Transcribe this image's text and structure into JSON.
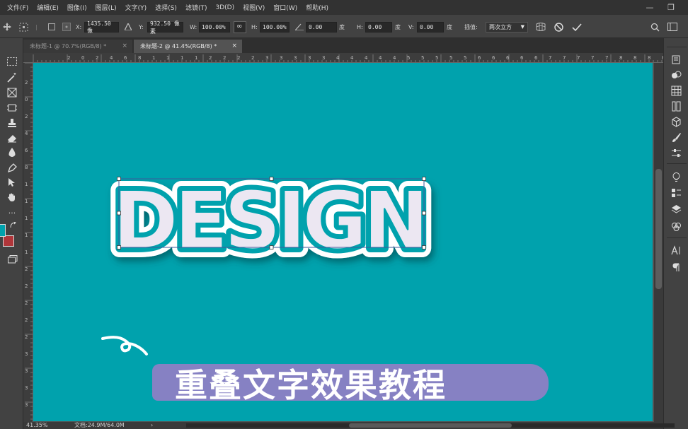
{
  "menu": [
    "文件(F)",
    "编辑(E)",
    "图像(I)",
    "图层(L)",
    "文字(Y)",
    "选择(S)",
    "滤镜(T)",
    "3D(D)",
    "视图(V)",
    "窗口(W)",
    "帮助(H)"
  ],
  "window_controls": {
    "minimize": "—",
    "restore": "❐"
  },
  "options": {
    "x_label": "X:",
    "x_value": "1435.50 像",
    "y_label": "Y:",
    "y_value": "932.50 像素",
    "w_label": "W:",
    "w_value": "100.00%",
    "h_label": "H:",
    "h_value": "100.00%",
    "angle_value": "0.00",
    "angle_unit": "度",
    "hskew_label": "H:",
    "hskew_value": "0.00",
    "hskew_unit": "度",
    "vskew_label": "V:",
    "vskew_value": "0.00",
    "vskew_unit": "度",
    "interp_label": "插值:",
    "interp_value": "两次立方"
  },
  "tabs": [
    {
      "label": "未标题-1 @ 70.7%(RGB/8) *",
      "close": "×"
    },
    {
      "label": "未标题-2 @ 41.4%(RGB/8) *",
      "close": "×"
    }
  ],
  "canvas": {
    "headline": "DESIGN",
    "subtitle": "重叠文字效果教程",
    "background": "#00a2ad",
    "text_fill": "#ece7f2",
    "text_stroke": "#00a2ad",
    "banner_color": "#8d7fc4"
  },
  "status": {
    "zoom": "41.35%",
    "doc": "文档:24.9M/64.0M",
    "arrow": "›"
  },
  "ruler_h_labels": [
    "2",
    "0",
    "2",
    "4",
    "6",
    "8",
    "1",
    "1",
    "1",
    "1",
    "2",
    "2",
    "2",
    "2",
    "3",
    "3",
    "3",
    "3",
    "3",
    "4",
    "4",
    "4",
    "4",
    "4",
    "5",
    "5",
    "5",
    "5",
    "5",
    "6",
    "6",
    "6",
    "6",
    "6",
    "7",
    "7",
    "7",
    "7",
    "7",
    "8",
    "8",
    "8",
    "8",
    "8",
    "9",
    "9"
  ],
  "ruler_v_labels": [
    "2",
    "0",
    "2",
    "4",
    "6",
    "8",
    "1",
    "1",
    "1",
    "1",
    "1",
    "2",
    "2",
    "2",
    "2",
    "2",
    "3",
    "3",
    "3",
    "3"
  ],
  "colors": {
    "foreground": "#00a2ad",
    "background": "#b0363a"
  }
}
